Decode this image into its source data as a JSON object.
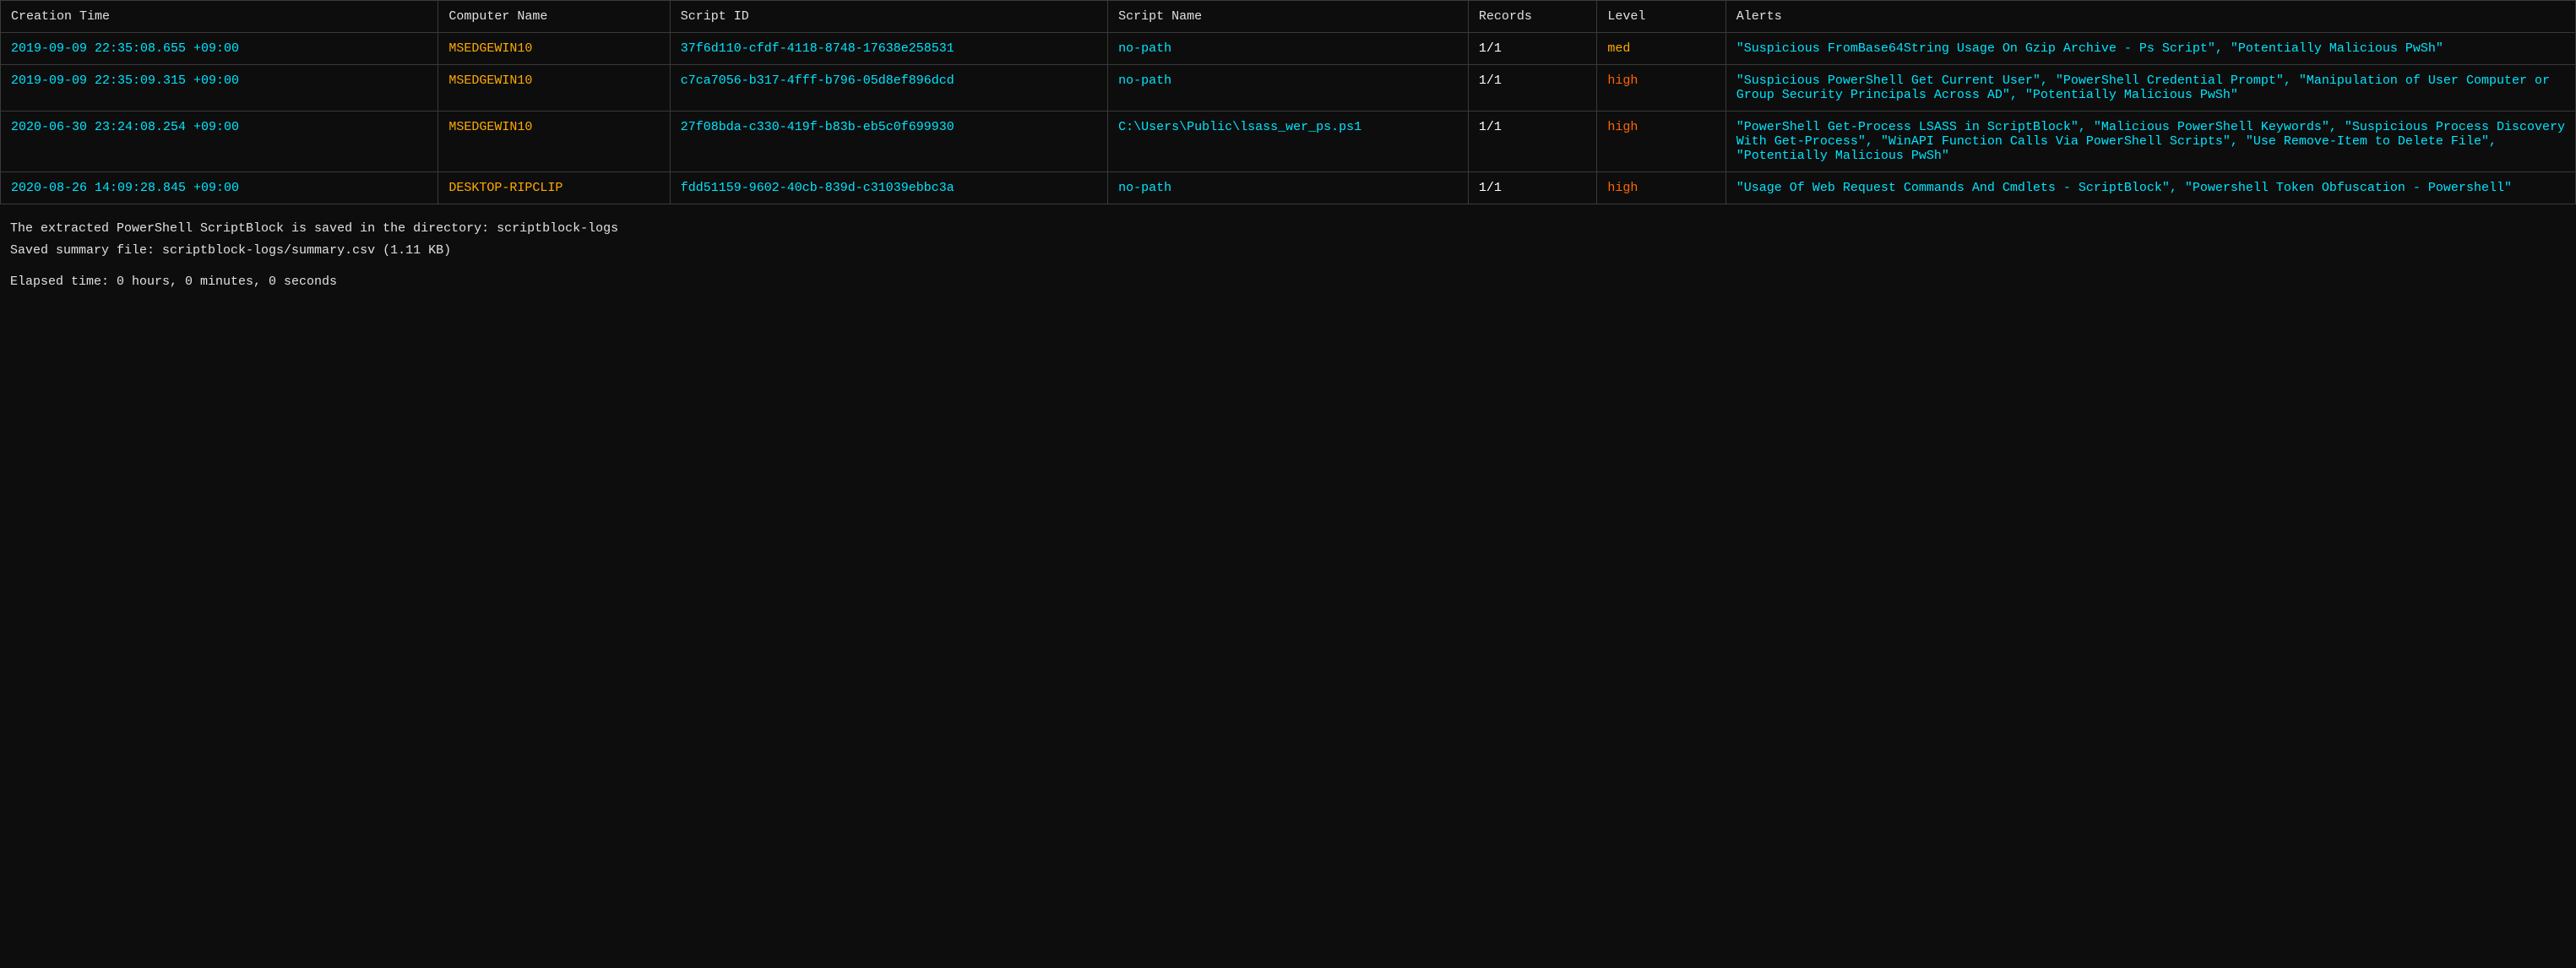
{
  "table": {
    "headers": [
      "Creation Time",
      "Computer Name",
      "Script ID",
      "Script Name",
      "Records",
      "Level",
      "Alerts"
    ],
    "rows": [
      {
        "time": "2019-09-09 22:35:08.655 +09:00",
        "computer": "MSEDGEWIN10",
        "scriptid": "37f6d110-cfdf-4118-8748-17638e258531",
        "scriptname": "no-path",
        "records": "1/1",
        "level": "med",
        "level_class": "cell-level-med",
        "alerts": "\"Suspicious FromBase64String Usage On Gzip Archive - Ps Script\", \"Potentially Malicious PwSh\""
      },
      {
        "time": "2019-09-09 22:35:09.315 +09:00",
        "computer": "MSEDGEWIN10",
        "scriptid": "c7ca7056-b317-4fff-b796-05d8ef896dcd",
        "scriptname": "no-path",
        "records": "1/1",
        "level": "high",
        "level_class": "cell-level-high",
        "alerts": "\"Suspicious PowerShell Get Current User\", \"PowerShell Credential Prompt\", \"Manipulation of User Computer or Group Security Principals Across AD\", \"Potentially Malicious PwSh\""
      },
      {
        "time": "2020-06-30 23:24:08.254 +09:00",
        "computer": "MSEDGEWIN10",
        "scriptid": "27f08bda-c330-419f-b83b-eb5c0f699930",
        "scriptname": "C:\\Users\\Public\\lsass_wer_ps.ps1",
        "records": "1/1",
        "level": "high",
        "level_class": "cell-level-high",
        "alerts": "\"PowerShell Get-Process LSASS in ScriptBlock\", \"Malicious PowerShell Keywords\", \"Suspicious Process Discovery With Get-Process\", \"WinAPI Function Calls Via PowerShell Scripts\", \"Use Remove-Item to Delete File\", \"Potentially Malicious PwSh\""
      },
      {
        "time": "2020-08-26 14:09:28.845 +09:00",
        "computer": "DESKTOP-RIPCLIP",
        "scriptid": "fdd51159-9602-40cb-839d-c31039ebbc3a",
        "scriptname": "no-path",
        "records": "1/1",
        "level": "high",
        "level_class": "cell-level-high",
        "alerts": "\"Usage Of Web Request Commands And Cmdlets - ScriptBlock\", \"Powershell Token Obfuscation - Powershell\""
      }
    ]
  },
  "footer": {
    "line1": "The extracted PowerShell ScriptBlock is saved in the directory: scriptblock-logs",
    "line2": "Saved summary file: scriptblock-logs/summary.csv (1.11 KB)",
    "line3": "Elapsed time: 0 hours, 0 minutes, 0 seconds"
  }
}
